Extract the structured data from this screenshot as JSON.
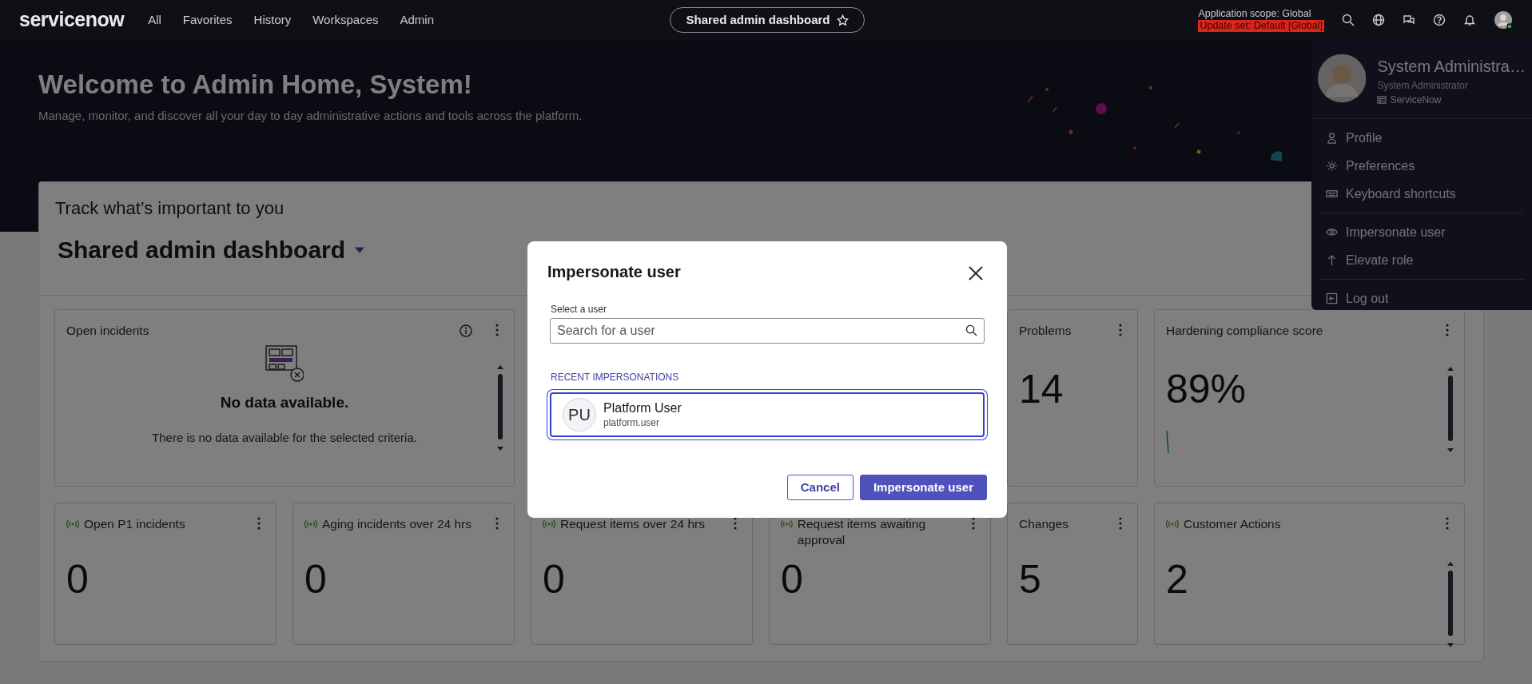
{
  "nav": {
    "logo": "servicenow",
    "items": [
      "All",
      "Favorites",
      "History",
      "Workspaces",
      "Admin"
    ],
    "dashboard_pill": {
      "label": "Shared admin dashboard",
      "starred": false
    },
    "scope": "Application scope: Global",
    "update_set": "Update set: Default [Global]"
  },
  "hero": {
    "title": "Welcome to Admin Home, System!",
    "subtitle": "Manage, monitor, and discover all your day to day administrative actions and tools across the platform."
  },
  "dashboard": {
    "heading": "Track what’s important to you",
    "name": "Shared admin dashboard",
    "rows": [
      [
        {
          "kind": "empty",
          "colspan": 2,
          "title": "Open incidents",
          "info": true,
          "live": false,
          "scrollable": true,
          "message": "No data available.",
          "detail": "There is no data available for the selected criteria."
        },
        "",
        "",
        {
          "kind": "metric",
          "title": "Problems",
          "info": false,
          "live": false,
          "scrollable": false,
          "value": "14"
        },
        {
          "kind": "trend",
          "title": "Hardening compliance score",
          "info": false,
          "live": false,
          "scrollable": true,
          "value": "89%"
        }
      ],
      [
        {
          "kind": "metric",
          "title": "Open P1 incidents",
          "info": false,
          "live": true,
          "scrollable": false,
          "value": "0"
        },
        {
          "kind": "metric",
          "title": "Aging incidents over 24 hrs",
          "info": false,
          "live": true,
          "scrollable": false,
          "value": "0"
        },
        {
          "kind": "metric",
          "title": "Request items over 24 hrs",
          "info": false,
          "live": true,
          "scrollable": false,
          "value": "0"
        },
        {
          "kind": "metric",
          "title": "Request items awaiting approval",
          "info": false,
          "live": true,
          "scrollable": false,
          "value": "0"
        },
        {
          "kind": "metric",
          "title": "Changes",
          "info": false,
          "live": false,
          "scrollable": false,
          "value": "5"
        },
        {
          "kind": "metric",
          "title": "Customer Actions",
          "info": false,
          "live": true,
          "scrollable": true,
          "value": "2"
        }
      ]
    ]
  },
  "user_menu": {
    "name": "System Administra…",
    "role": "System Administrator",
    "company": "ServiceNow",
    "groups": [
      [
        "Profile",
        "Preferences",
        "Keyboard shortcuts"
      ],
      [
        "Impersonate user",
        "Elevate role"
      ],
      [
        "Log out"
      ]
    ]
  },
  "dialog": {
    "title": "Impersonate user",
    "field_label": "Select a user",
    "placeholder": "Search for a user",
    "section": "RECENT IMPERSONATIONS",
    "users": [
      {
        "initials": "PU",
        "name": "Platform User",
        "username": "platform.user",
        "selected": true
      }
    ],
    "buttons": [
      {
        "label": "Cancel",
        "kind": "secondary"
      },
      {
        "label": "Impersonate user",
        "kind": "primary"
      }
    ]
  }
}
